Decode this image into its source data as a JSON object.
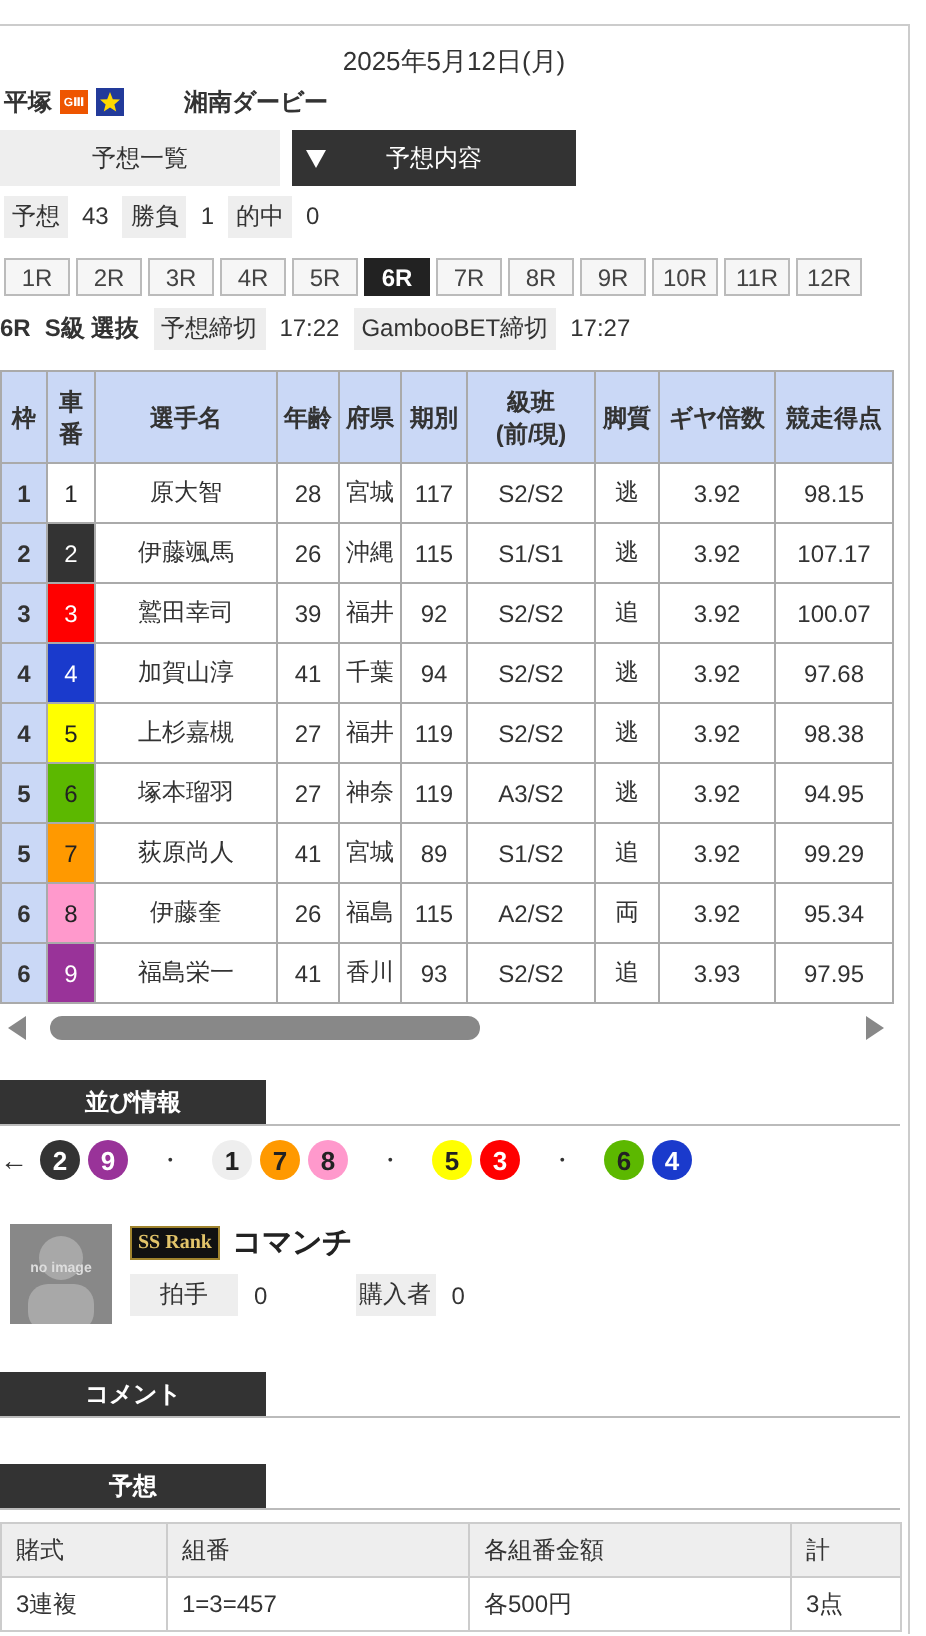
{
  "date": "2025年5月12日(月)",
  "venue": {
    "name": "平塚",
    "grade": "GⅢ",
    "race_title": "湘南ダービー"
  },
  "tabs": [
    {
      "label": "予想一覧",
      "selected": false
    },
    {
      "label": "予想内容",
      "selected": true
    }
  ],
  "stats": [
    {
      "label": "予想",
      "value": "43"
    },
    {
      "label": "勝負",
      "value": "1"
    },
    {
      "label": "的中",
      "value": "0"
    }
  ],
  "races": [
    {
      "label": "1R",
      "selected": false
    },
    {
      "label": "2R",
      "selected": false
    },
    {
      "label": "3R",
      "selected": false
    },
    {
      "label": "4R",
      "selected": false
    },
    {
      "label": "5R",
      "selected": false
    },
    {
      "label": "6R",
      "selected": true
    },
    {
      "label": "7R",
      "selected": false
    },
    {
      "label": "8R",
      "selected": false
    },
    {
      "label": "9R",
      "selected": false
    },
    {
      "label": "10R",
      "selected": false
    },
    {
      "label": "11R",
      "selected": false
    },
    {
      "label": "12R",
      "selected": false
    }
  ],
  "race_info": {
    "race": "6R",
    "class": "S級 選抜",
    "deadlines": [
      {
        "label": "予想締切",
        "time": "17:22"
      },
      {
        "label": "GambooBET締切",
        "time": "17:27"
      }
    ]
  },
  "entries": {
    "columns": [
      "枠",
      "車番",
      "選手名",
      "年齢",
      "府県",
      "期別",
      "級班\n(前/現)",
      "脚質",
      "ギヤ倍数",
      "競走得点"
    ],
    "rows": [
      {
        "frame": "1",
        "number": "1",
        "color": "#ffffff",
        "name": "原大智",
        "age": "28",
        "pref": "宮城",
        "term": "117",
        "class": "S2/S2",
        "style": "逃",
        "gear": "3.92",
        "score": "98.15"
      },
      {
        "frame": "2",
        "number": "2",
        "color": "#333333",
        "name": "伊藤颯馬",
        "age": "26",
        "pref": "沖縄",
        "term": "115",
        "class": "S1/S1",
        "style": "逃",
        "gear": "3.92",
        "score": "107.17"
      },
      {
        "frame": "3",
        "number": "3",
        "color": "#ff0000",
        "name": "鷲田幸司",
        "age": "39",
        "pref": "福井",
        "term": "92",
        "class": "S2/S2",
        "style": "追",
        "gear": "3.92",
        "score": "100.07"
      },
      {
        "frame": "4",
        "number": "4",
        "color": "#1a3acc",
        "name": "加賀山淳",
        "age": "41",
        "pref": "千葉",
        "term": "94",
        "class": "S2/S2",
        "style": "逃",
        "gear": "3.92",
        "score": "97.68"
      },
      {
        "frame": "4",
        "number": "5",
        "color": "#ffff00",
        "name": "上杉嘉槻",
        "age": "27",
        "pref": "福井",
        "term": "119",
        "class": "S2/S2",
        "style": "逃",
        "gear": "3.92",
        "score": "98.38"
      },
      {
        "frame": "5",
        "number": "6",
        "color": "#5cb800",
        "name": "塚本瑠羽",
        "age": "27",
        "pref": "神奈",
        "term": "119",
        "class": "A3/S2",
        "style": "逃",
        "gear": "3.92",
        "score": "94.95"
      },
      {
        "frame": "5",
        "number": "7",
        "color": "#ff9900",
        "name": "荻原尚人",
        "age": "41",
        "pref": "宮城",
        "term": "89",
        "class": "S1/S2",
        "style": "追",
        "gear": "3.92",
        "score": "99.29"
      },
      {
        "frame": "6",
        "number": "8",
        "color": "#ff99cc",
        "name": "伊藤奎",
        "age": "26",
        "pref": "福島",
        "term": "115",
        "class": "A2/S2",
        "style": "両",
        "gear": "3.92",
        "score": "95.34"
      },
      {
        "frame": "6",
        "number": "9",
        "color": "#993399",
        "name": "福島栄一",
        "age": "41",
        "pref": "香川",
        "term": "93",
        "class": "S2/S2",
        "style": "追",
        "gear": "3.93",
        "score": "97.95"
      }
    ]
  },
  "line_order": {
    "title": "並び情報",
    "direction": "←",
    "items": [
      {
        "kind": "car",
        "number": "2",
        "color": "#333333"
      },
      {
        "kind": "car",
        "number": "9",
        "color": "#993399"
      },
      {
        "kind": "separator",
        "text": "・"
      },
      {
        "kind": "car",
        "number": "1",
        "color": "#eeeeee"
      },
      {
        "kind": "car",
        "number": "7",
        "color": "#ff9900"
      },
      {
        "kind": "car",
        "number": "8",
        "color": "#ff99cc"
      },
      {
        "kind": "separator",
        "text": "・"
      },
      {
        "kind": "car",
        "number": "5",
        "color": "#ffff00"
      },
      {
        "kind": "car",
        "number": "3",
        "color": "#ff0000"
      },
      {
        "kind": "separator",
        "text": "・"
      },
      {
        "kind": "car",
        "number": "6",
        "color": "#5cb800"
      },
      {
        "kind": "car",
        "number": "4",
        "color": "#1a3acc"
      }
    ]
  },
  "tipster": {
    "avatar_text": "no image",
    "rank": "SS Rank",
    "name": "コマンチ",
    "stats": [
      {
        "label": "拍手",
        "value": "0"
      },
      {
        "label": "購入者",
        "value": "0"
      }
    ]
  },
  "comment": {
    "title": "コメント"
  },
  "prediction": {
    "title": "予想",
    "columns": [
      "賭式",
      "組番",
      "各組番金額",
      "計"
    ],
    "rows": [
      [
        "3連複",
        "1=3=457",
        "各500円",
        "3点"
      ]
    ]
  }
}
